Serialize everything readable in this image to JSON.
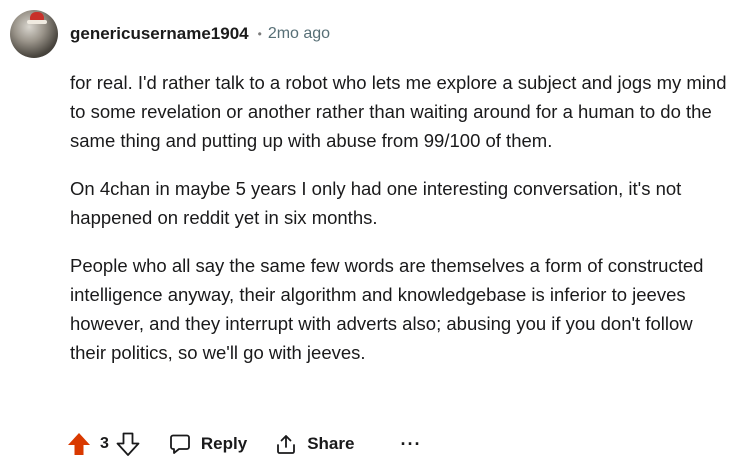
{
  "comment": {
    "author": "genericusername1904",
    "separator": "•",
    "time": "2mo ago",
    "paragraphs": [
      "for real. I'd rather talk to a robot who lets me explore a subject and jogs my mind to some revelation or another rather than waiting around for a human to do the same thing and putting up with abuse from 99/100 of them.",
      "On 4chan in maybe 5 years I only had one interesting conversation, it's not happened on reddit yet in six months.",
      "People who all say the same few words are themselves a form of constructed intelligence anyway, their algorithm and knowledgebase is inferior to jeeves however, and they interrupt with adverts also; abusing you if you don't follow their politics, so we'll go with jeeves."
    ]
  },
  "actions": {
    "score": "3",
    "reply_label": "Reply",
    "share_label": "Share",
    "more_label": "···"
  },
  "colors": {
    "upvote_active": "#d93900",
    "meta_text": "#576f76"
  }
}
